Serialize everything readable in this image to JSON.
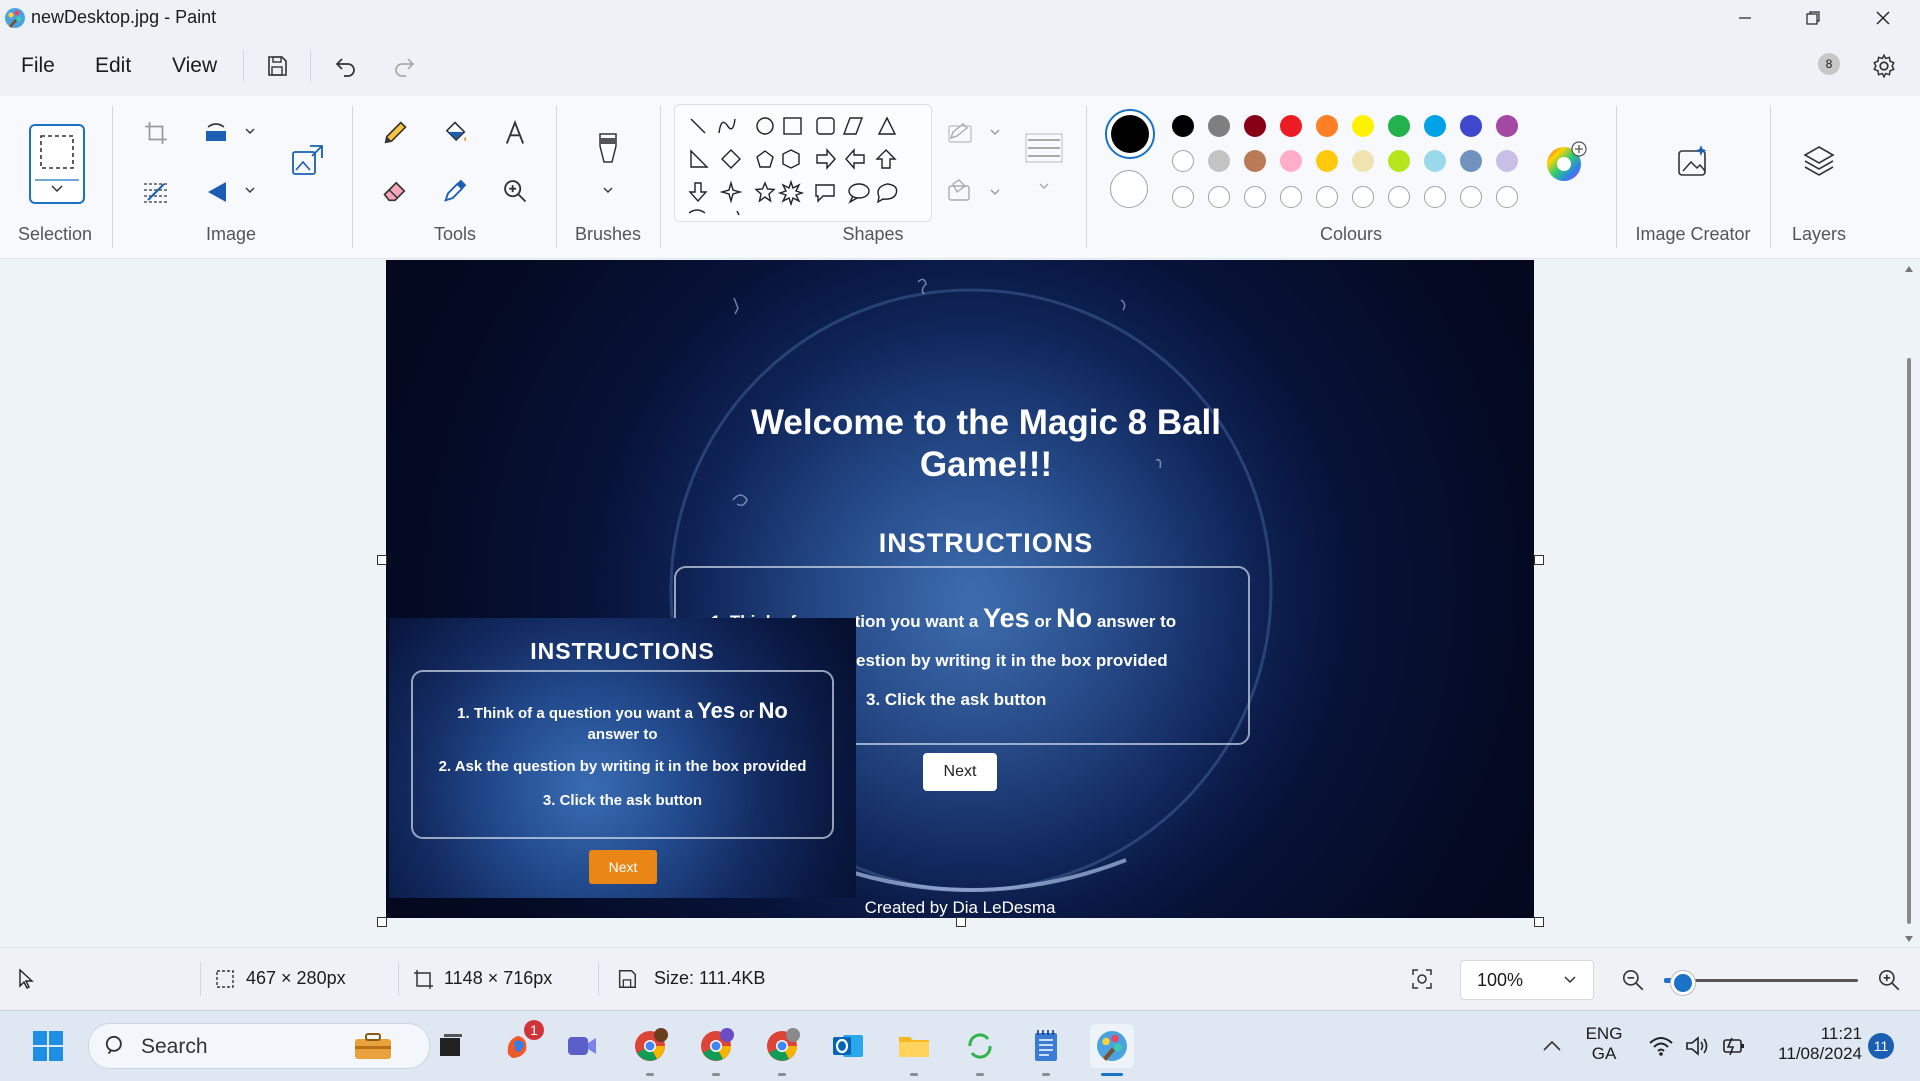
{
  "window": {
    "title": "newDesktop.jpg - Paint"
  },
  "menu": {
    "file": "File",
    "edit": "Edit",
    "view": "View",
    "profile_initial": "8"
  },
  "ribbon": {
    "groups": {
      "selection": "Selection",
      "image": "Image",
      "tools": "Tools",
      "brushes": "Brushes",
      "shapes": "Shapes",
      "colours": "Colours",
      "image_creator": "Image Creator",
      "layers": "Layers"
    },
    "palette_row1": [
      "#000000",
      "#7f7f7f",
      "#880015",
      "#ed1c24",
      "#ff7f27",
      "#fff200",
      "#22b14c",
      "#00a2e8",
      "#3f48cc",
      "#a349a4"
    ],
    "palette_row2": [
      "#ffffff",
      "#c3c3c3",
      "#b97a57",
      "#ffaec9",
      "#ffc90e",
      "#efe4b0",
      "#b5e61d",
      "#99d9ea",
      "#7092be",
      "#c8bfe7"
    ],
    "primary_color": "#000000",
    "secondary_color": "#ffffff"
  },
  "canvas": {
    "welcome": "Welcome to the Magic 8 Ball Game!!!",
    "instructions_title": "INSTRUCTIONS",
    "step1_pre": "1. Think of a question you want a",
    "yes": "Yes",
    "or": "or",
    "no": "No",
    "step1_post": "answer to",
    "step2_visible": "estion by writing it in the box provided",
    "step3": "3. Click the ask button",
    "next": "Next",
    "created_by": "Created by Dia LeDesma",
    "pasted": {
      "instructions_title": "INSTRUCTIONS",
      "step1_pre": "1. Think of a question you want a",
      "yes": "Yes",
      "or": "or",
      "no": "No",
      "step1_post": "answer to",
      "step2": "2. Ask the question by writing it in the box provided",
      "step3": "3. Click the ask button",
      "next": "Next"
    }
  },
  "status": {
    "selection_size": "467 × 280px",
    "canvas_size": "1148 × 716px",
    "file_size": "Size: 111.4KB",
    "zoom": "100%",
    "zoom_level_fraction": 0.1
  },
  "taskbar": {
    "search": "Search",
    "notification_badge": "1",
    "language_top": "ENG",
    "language_bottom": "GA",
    "time": "11:21",
    "date": "11/08/2024",
    "notifications": "11"
  }
}
